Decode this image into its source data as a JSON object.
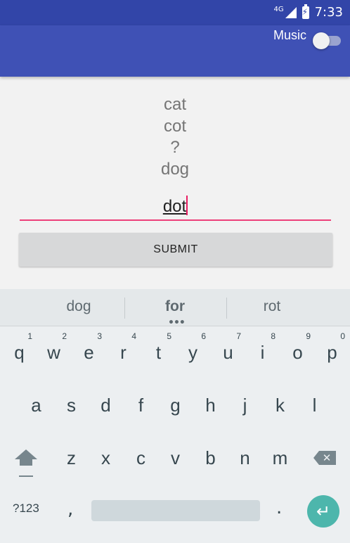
{
  "status": {
    "network": "4G",
    "time": "7:33"
  },
  "appbar": {
    "music_label": "Music",
    "music_on": false
  },
  "content": {
    "words": [
      "cat",
      "cot",
      "?",
      "dog"
    ],
    "input_value": "dot",
    "submit_label": "SUBMIT"
  },
  "keyboard": {
    "suggestions": [
      "dog",
      "for",
      "rot"
    ],
    "row1": [
      [
        "q",
        "1"
      ],
      [
        "w",
        "2"
      ],
      [
        "e",
        "3"
      ],
      [
        "r",
        "4"
      ],
      [
        "t",
        "5"
      ],
      [
        "y",
        "6"
      ],
      [
        "u",
        "7"
      ],
      [
        "i",
        "8"
      ],
      [
        "o",
        "9"
      ],
      [
        "p",
        "0"
      ]
    ],
    "row2": [
      "a",
      "s",
      "d",
      "f",
      "g",
      "h",
      "j",
      "k",
      "l"
    ],
    "row3": [
      "z",
      "x",
      "c",
      "v",
      "b",
      "n",
      "m"
    ],
    "symbols_label": "?123",
    "comma": ",",
    "period": ".",
    "icons": {
      "shift": "shift-icon",
      "backspace": "backspace-icon",
      "enter": "enter-icon"
    },
    "accent_color": "#4db6ac"
  },
  "colors": {
    "primary": "#3f51b5",
    "status": "#3245a8",
    "input_accent": "#ec407a"
  }
}
